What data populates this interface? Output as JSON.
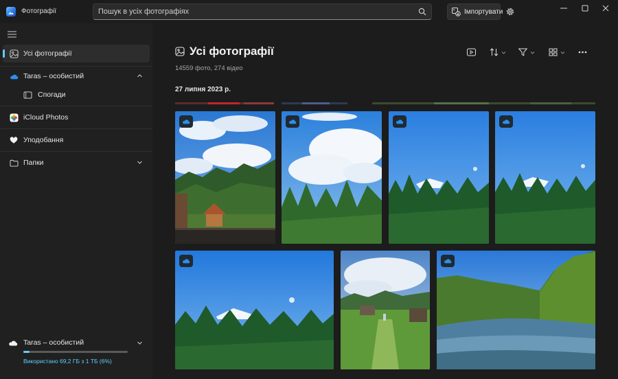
{
  "window": {
    "app_title": "Фотографії"
  },
  "search": {
    "placeholder": "Пошук в усіх фотографіях"
  },
  "toolbar": {
    "import_label": "Імпортувати"
  },
  "sidebar": {
    "items": [
      {
        "label": "Усі фотографії",
        "icon": "photo-icon"
      },
      {
        "label": "Taras – особистий",
        "icon": "onedrive-cloud-icon"
      },
      {
        "label": "Спогади",
        "icon": "memories-icon"
      },
      {
        "label": "iCloud Photos",
        "icon": "icloud-icon"
      },
      {
        "label": "Уподобання",
        "icon": "heart-icon"
      },
      {
        "label": "Папки",
        "icon": "folder-icon"
      }
    ],
    "storage": {
      "account": "Taras – особистий",
      "used_text": "Використано 69,2 ГБ з 1 ТБ (6%)",
      "used_fraction": 0.06
    }
  },
  "main": {
    "title": "Усі фотографії",
    "counts": "14559 фото, 274 відео",
    "date_header": "27 липня 2023 р."
  },
  "colors": {
    "accent": "#60cdff",
    "background": "#1c1c1c",
    "sidebar": "#202020"
  }
}
